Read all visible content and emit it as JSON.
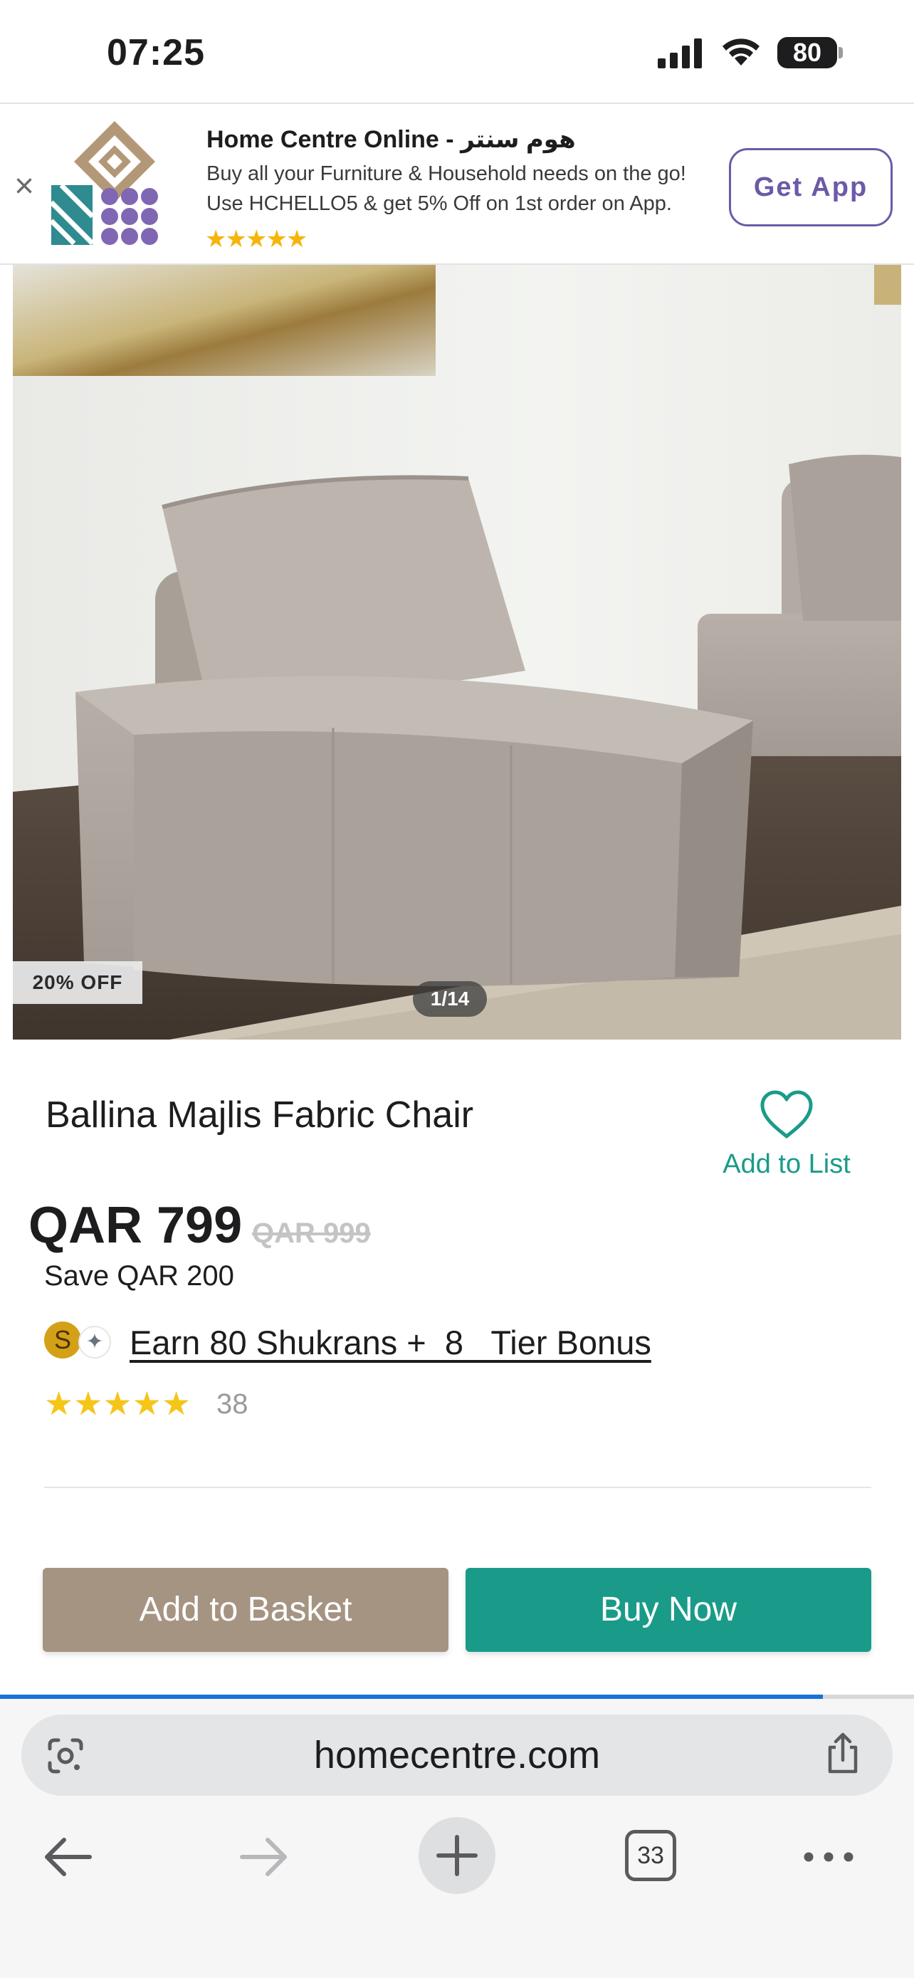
{
  "status_bar": {
    "time": "07:25",
    "battery": "80"
  },
  "app_banner": {
    "title": "Home Centre Online - هوم سنتر",
    "line1": "Buy all your Furniture & Household needs on the go!",
    "line2": "Use HCHELLO5 & get 5% Off on 1st order on App.",
    "stars": "★★★★★",
    "get_app_label": "Get App",
    "close_icon": "close-icon"
  },
  "product": {
    "discount_badge": "20% OFF",
    "image_counter": "1/14",
    "title": "Ballina Majlis Fabric Chair",
    "add_to_list_label": "Add to List",
    "price": "QAR 799",
    "old_price": "QAR 999",
    "save_text": "Save QAR 200",
    "shukran_text": "Earn 80 Shukrans +  8   Tier Bonus",
    "shukran_badge": "S",
    "rating_stars": "★★★★★",
    "rating_value": 5,
    "rating_count": "38"
  },
  "actions": {
    "add_to_basket": "Add to Basket",
    "buy_now": "Buy Now"
  },
  "browser": {
    "url": "homecentre.com",
    "tab_count": "33",
    "load_progress": 0.9
  },
  "colors": {
    "accent_teal": "#1a9b89",
    "basket_brown": "#a59482",
    "banner_purple": "#6c5aa8",
    "star_yellow": "#f5c518",
    "progress_blue": "#1a6fd9"
  }
}
